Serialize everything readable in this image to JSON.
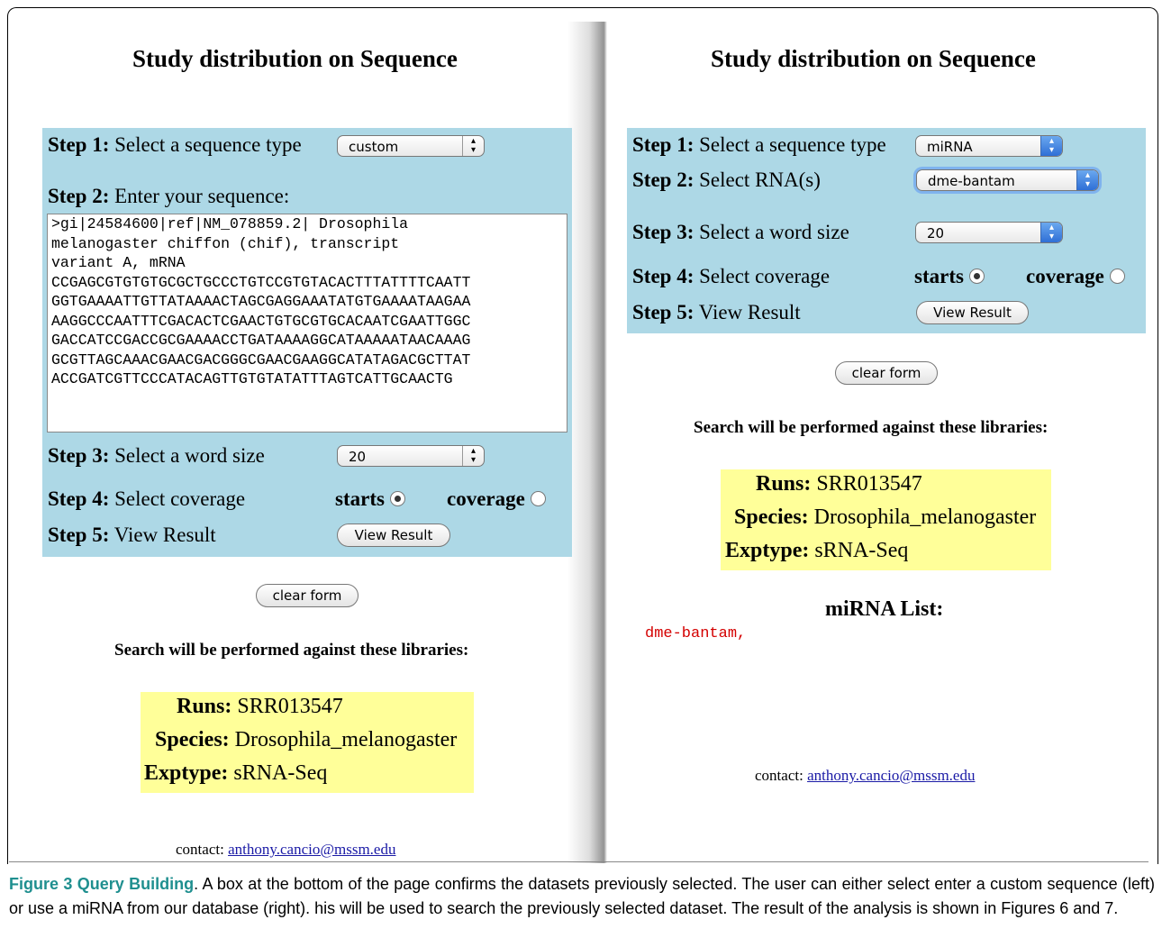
{
  "left": {
    "title": "Study distribution on Sequence",
    "step1_label": "Step 1:",
    "step1_text": "Select a sequence type",
    "seq_type_value": "custom",
    "step2_label": "Step 2:",
    "step2_text": "Enter your sequence:",
    "sequence_text": ">gi|24584600|ref|NM_078859.2| Drosophila\nmelanogaster chiffon (chif), transcript\nvariant A, mRNA\nCCGAGCGTGTGTGCGCTGCCCTGTCCGTGTACACTTTATTTTCAATT\nGGTGAAAATTGTTATAAAACTAGCGAGGAAATATGTGAAAATAAGAA\nAAGGCCCAATTTCGACACTCGAACTGTGCGTGCACAATCGAATTGGC\nGACCATCCGACCGCGAAAACCTGATAAAAGGCATAAAAATAACAAAG\nGCGTTAGCAAACGAACGACGGGCGAACGAAGGCATATAGACGCTTAT\nACCGATCGTTCCCATACAGTTGTGTATATTTAGTCATTGCAACTG",
    "step3_label": "Step 3:",
    "step3_text": "Select a word size",
    "word_size_value": "20",
    "step4_label": "Step 4:",
    "step4_text": "Select coverage",
    "radio_starts": "starts",
    "radio_coverage": "coverage",
    "step5_label": "Step 5:",
    "step5_text": "View Result",
    "view_result_button": "View Result",
    "clear_form_button": "clear form",
    "libraries_heading": "Search will be performed against these libraries:",
    "runs_label": "Runs:",
    "runs_value": "SRR013547",
    "species_label": "Species:",
    "species_value": "Drosophila_melanogaster",
    "exptype_label": "Exptype:",
    "exptype_value": "sRNA-Seq",
    "contact_label": "contact:",
    "contact_email": "anthony.cancio@mssm.edu"
  },
  "right": {
    "title": "Study distribution on Sequence",
    "step1_label": "Step 1:",
    "step1_text": "Select a sequence type",
    "seq_type_value": "miRNA",
    "step2_label": "Step 2:",
    "step2_text": "Select RNA(s)",
    "rna_value": "dme-bantam",
    "step3_label": "Step 3:",
    "step3_text": "Select a word size",
    "word_size_value": "20",
    "step4_label": "Step 4:",
    "step4_text": "Select coverage",
    "radio_starts": "starts",
    "radio_coverage": "coverage",
    "step5_label": "Step 5:",
    "step5_text": "View Result",
    "view_result_button": "View Result",
    "clear_form_button": "clear form",
    "libraries_heading": "Search will be performed against these libraries:",
    "runs_label": "Runs:",
    "runs_value": "SRR013547",
    "species_label": "Species:",
    "species_value": "Drosophila_melanogaster",
    "exptype_label": "Exptype:",
    "exptype_value": "sRNA-Seq",
    "mirna_list_heading": "miRNA List:",
    "mirna_list_item": "dme-bantam,",
    "contact_label": "contact:",
    "contact_email": "anthony.cancio@mssm.edu"
  },
  "caption": {
    "figure_label": "Figure 3 Query Building",
    "text": ". A box at the bottom of the page confirms the datasets previously selected. The user can either select enter a custom sequence (left) or use a miRNA from our database (right). his will be used to search the previously selected dataset. The result of the analysis is shown in Figures 6 and 7."
  },
  "colors": {
    "step_box": "#add8e6",
    "library_box": "#ffff99",
    "mirna_text": "#d40000",
    "caption_label": "#1f8f8f"
  },
  "icons": {
    "select_arrows": "up-down-arrows-icon",
    "radio": "radio-button-icon"
  }
}
